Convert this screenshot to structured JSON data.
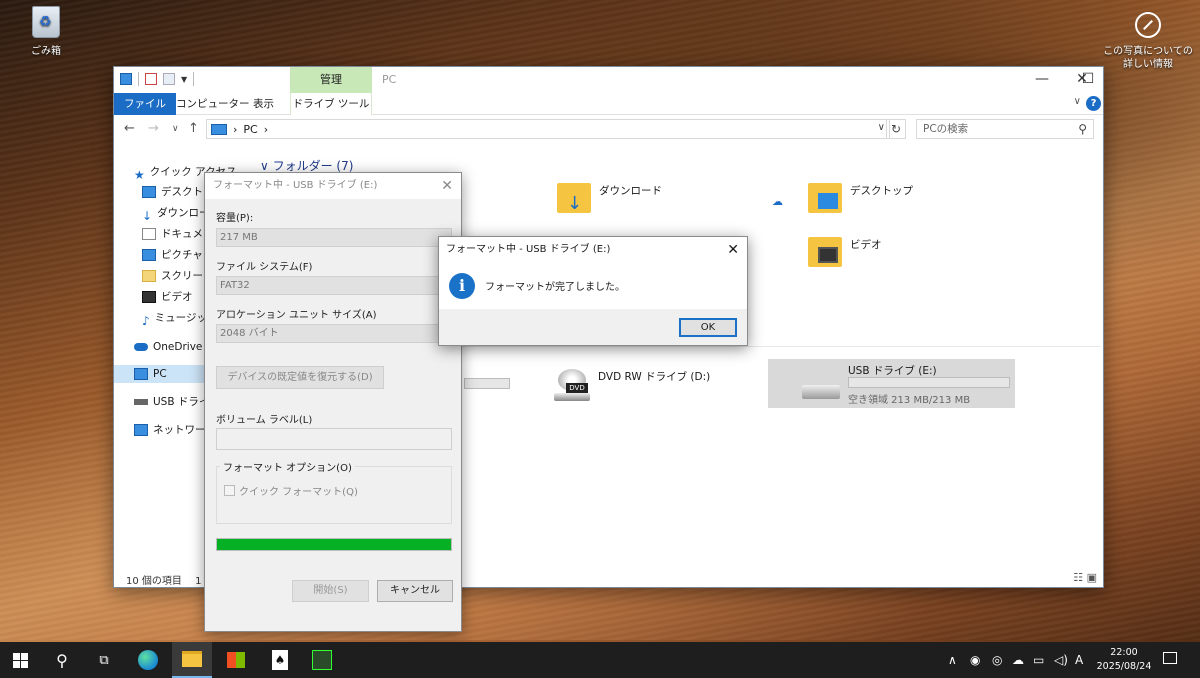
{
  "desktop": {
    "recycle_bin_label": "ごみ箱",
    "photo_info_label": "この写真についての詳しい情報"
  },
  "explorer": {
    "window_title": "PC",
    "manage_tab": "管理",
    "drive_tools_tab": "ドライブ ツール",
    "ribbon_tabs": [
      "ファイル",
      "コンピューター",
      "表示"
    ],
    "address_path": "PC",
    "search_placeholder": "PCの検索",
    "nav_items": [
      "クイック アクセス",
      "デスクトップ",
      "ダウンロード",
      "ドキュメント",
      "ピクチャ",
      "スクリーンシ",
      "ビデオ",
      "ミュージック",
      "OneDrive -",
      "PC",
      "USB ドライブ",
      "ネットワーク"
    ],
    "folders_header": "フォルダー (7)",
    "folders": [
      "ダウンロード",
      "デスクトップ",
      "ビデオ"
    ],
    "dvd_drive": "DVD RW ドライブ (D:)",
    "dvd_badge": "DVD",
    "usb_drive": {
      "name": "USB ドライブ (E:)",
      "free_space": "空き領域 213 MB/213 MB",
      "used_fraction": 0
    },
    "status_items": "10 個の項目",
    "status_extra": "1"
  },
  "format_dialog": {
    "title": "フォーマット中 - USB ドライブ (E:)",
    "capacity_label": "容量(P):",
    "capacity_value": "217 MB",
    "filesystem_label": "ファイル システム(F)",
    "filesystem_value": "FAT32",
    "alloc_label": "アロケーション ユニット サイズ(A)",
    "alloc_value": "2048 バイト",
    "restore_button": "デバイスの既定値を復元する(D)",
    "volume_label": "ボリューム ラベル(L)",
    "volume_value": "",
    "options_label": "フォーマット オプション(O)",
    "quick_format": "クイック フォーマット(Q)",
    "progress": 1.0,
    "start_button": "開始(S)",
    "cancel_button": "キャンセル"
  },
  "message_box": {
    "title": "フォーマット中 - USB ドライブ (E:)",
    "text": "フォーマットが完了しました。",
    "ok_button": "OK"
  },
  "taskbar": {
    "time": "22:00",
    "date": "2025/08/24"
  },
  "colors": {
    "accent": "#1a6cc4",
    "progress_green": "#06b025",
    "manage_tab_bg": "#c8e8b8"
  }
}
